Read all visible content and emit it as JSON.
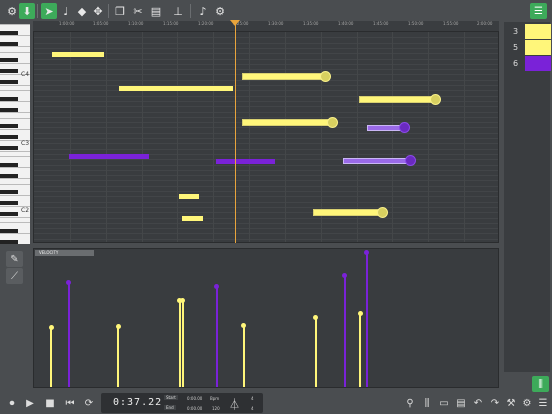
{
  "toolbar": {
    "tools": [
      "settings",
      "record",
      "select",
      "draw-note",
      "erase",
      "move",
      "copy",
      "cut",
      "paste",
      "quantize",
      "metronome-note",
      "settings-gear"
    ],
    "accent": "#3daa5a"
  },
  "keyboard": {
    "octave_labels": [
      "C4",
      "C3",
      "C2"
    ]
  },
  "ruler": {
    "ticks": [
      "1:00:00",
      "1:05:00",
      "1:10:00",
      "1:15:00",
      "1:20:00",
      "1:25:00",
      "1:30:00",
      "1:35:00",
      "1:40:00",
      "1:45:00",
      "1:50:00",
      "1:55:00",
      "2:00:00"
    ]
  },
  "tracks": [
    {
      "num": "3",
      "color": "#fff67a"
    },
    {
      "num": "5",
      "color": "#fff67a"
    },
    {
      "num": "6",
      "color": "#7a22d8"
    }
  ],
  "velocity": {
    "label": "VELOCITY"
  },
  "transport": {
    "time": "0:37.22",
    "start_label": "Start",
    "end_label": "End",
    "start_value": "0:00.00",
    "end_value": "0:00.00",
    "bpm_label": "Bpm",
    "bpm_value": "120",
    "sig_top": "4",
    "sig_bottom": "4"
  }
}
